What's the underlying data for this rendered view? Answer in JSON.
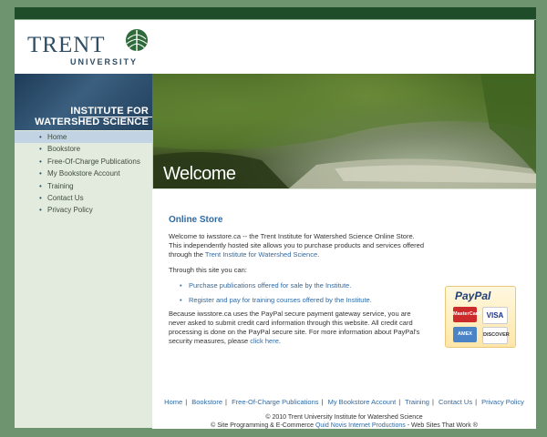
{
  "brand": {
    "logo_word": "TRENT",
    "logo_sub": "UNIVERSITY",
    "banner_line1": "INSTITUTE FOR",
    "banner_line2": "WATERSHED SCIENCE",
    "welcome": "Welcome"
  },
  "nav": [
    {
      "label": "Home",
      "active": true
    },
    {
      "label": "Bookstore"
    },
    {
      "label": "Free-Of-Charge Publications"
    },
    {
      "label": "My Bookstore Account"
    },
    {
      "label": "Training"
    },
    {
      "label": "Contact Us"
    },
    {
      "label": "Privacy Policy"
    }
  ],
  "main": {
    "heading": "Online Store",
    "intro_text": "Welcome to iwsstore.ca -- the Trent Institute for Watershed Science Online Store. This independently hosted site allows you to purchase products and services offered through the ",
    "intro_link": "Trent Institute for Watershed Science",
    "intro_end": ".",
    "through": "Through this site you can:",
    "bullets": [
      "Purchase publications offered for sale by the Institute.",
      "Register and pay for training courses offered by the Institute."
    ],
    "paypal_text": "Because iwsstore.ca uses the PayPal secure payment gateway service, you are never asked to submit credit card information through this website. All credit card processing is done on the PayPal secure site. For more information about PayPal's security measures, please ",
    "paypal_link": "click here",
    "paypal_end": "."
  },
  "paypal_badge": {
    "title": "PayPal",
    "cards": [
      "MasterCard",
      "VISA",
      "AMEX",
      "DISCOVER"
    ]
  },
  "footer": {
    "links": [
      "Home",
      "Bookstore",
      "Free-Of-Charge Publications",
      "My Bookstore Account",
      "Training",
      "Contact Us",
      "Privacy Policy"
    ],
    "separator": "|",
    "copyright": "© 2010 Trent University Institute for Watershed Science",
    "credit_pre": "© Site Programming & E-Commerce ",
    "credit_link": "Quid Novis Internet Productions",
    "credit_post": " - Web Sites That Work ®"
  },
  "colors": {
    "accent": "#2f6aa3",
    "topbar": "#1f4d2a",
    "background": "#6e946f"
  }
}
